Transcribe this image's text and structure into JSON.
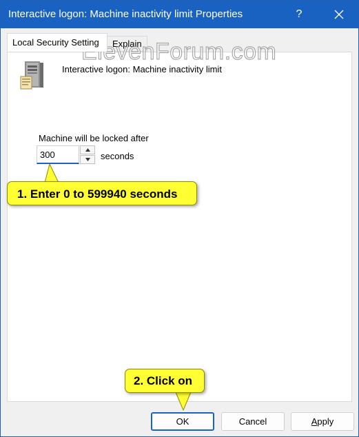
{
  "window": {
    "title": "Interactive logon: Machine inactivity limit Properties",
    "help_glyph": "?",
    "close_glyph": "✕"
  },
  "tabs": [
    {
      "label": "Local Security Setting",
      "active": true
    },
    {
      "label": "Explain",
      "active": false
    }
  ],
  "policy": {
    "name": "Interactive logon: Machine inactivity limit",
    "icon": "server-icon"
  },
  "setting": {
    "label": "Machine will be locked after",
    "value": "300",
    "units": "seconds"
  },
  "watermark": "ElevenForum.com",
  "callouts": {
    "step1": "1. Enter 0 to 599940 seconds",
    "step2": "2. Click on"
  },
  "buttons": {
    "ok": "OK",
    "cancel": "Cancel",
    "apply_accel": "A",
    "apply_rest": "pply"
  },
  "colors": {
    "titlebar": "#1a62c2",
    "callout": "#ffff33",
    "focus": "#1a62c2"
  }
}
